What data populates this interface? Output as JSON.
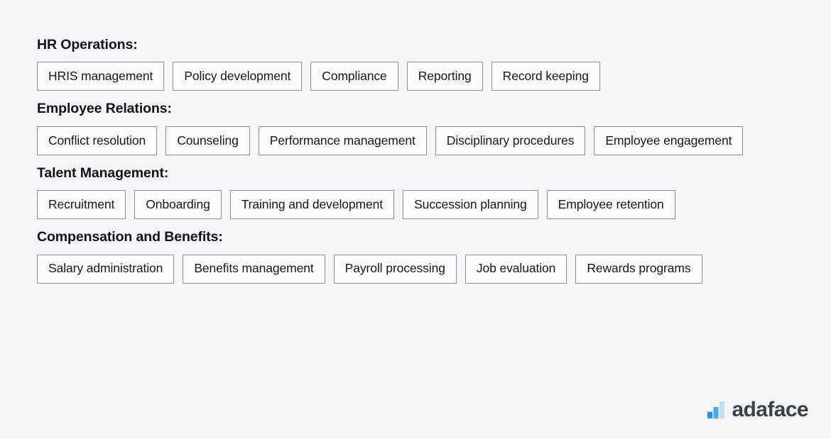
{
  "page": {
    "background_color": "#f4f5f7",
    "tag_border_color": "#8a8d91",
    "tag_fill_color": "#fbfbfc",
    "heading_color": "#111316"
  },
  "sections": [
    {
      "heading": "HR Operations:",
      "tags": [
        "HRIS management",
        "Policy development",
        "Compliance",
        "Reporting",
        "Record keeping"
      ]
    },
    {
      "heading": "Employee Relations:",
      "tags": [
        "Conflict resolution",
        "Counseling",
        "Performance management",
        "Disciplinary procedures",
        "Employee engagement"
      ]
    },
    {
      "heading": "Talent Management:",
      "tags": [
        "Recruitment",
        "Onboarding",
        "Training and development",
        "Succession planning",
        "Employee retention"
      ]
    },
    {
      "heading": "Compensation and Benefits:",
      "tags": [
        "Salary administration",
        "Benefits management",
        "Payroll processing",
        "Job evaluation",
        "Rewards programs"
      ]
    }
  ],
  "logo": {
    "wordmark": "adaface",
    "wordmark_color": "#3c4043",
    "bar_colors": [
      "#2f8fe0",
      "#4aa8ef",
      "#bfe0f8"
    ]
  }
}
